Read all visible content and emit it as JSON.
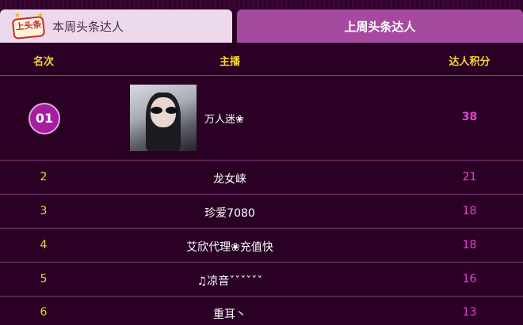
{
  "badge": {
    "text": "上头条"
  },
  "tabs": [
    {
      "label": "本周头条达人",
      "active": false
    },
    {
      "label": "上周头条达人",
      "active": true
    }
  ],
  "table": {
    "headers": {
      "rank": "名次",
      "name": "主播",
      "score": "达人积分"
    },
    "rows": [
      {
        "rank": "01",
        "name": "万人迷❀",
        "score": "38"
      },
      {
        "rank": "2",
        "name": "龙女崃",
        "score": "21"
      },
      {
        "rank": "3",
        "name": "珍爱7080",
        "score": "18"
      },
      {
        "rank": "4",
        "name": "艾欣代理❀充值快",
        "score": "18"
      },
      {
        "rank": "5",
        "name": "♫凉音ˇˇˇˇˇˇ",
        "score": "16"
      },
      {
        "rank": "6",
        "name": "重耳丶",
        "score": "13"
      }
    ]
  },
  "colors": {
    "background": "#2a0025",
    "active_tab": "#a64aa0",
    "inactive_tab": "#ecd9ec",
    "header_text": "#f7d531",
    "score_text": "#e645d5",
    "divider": "#8a3d86"
  }
}
